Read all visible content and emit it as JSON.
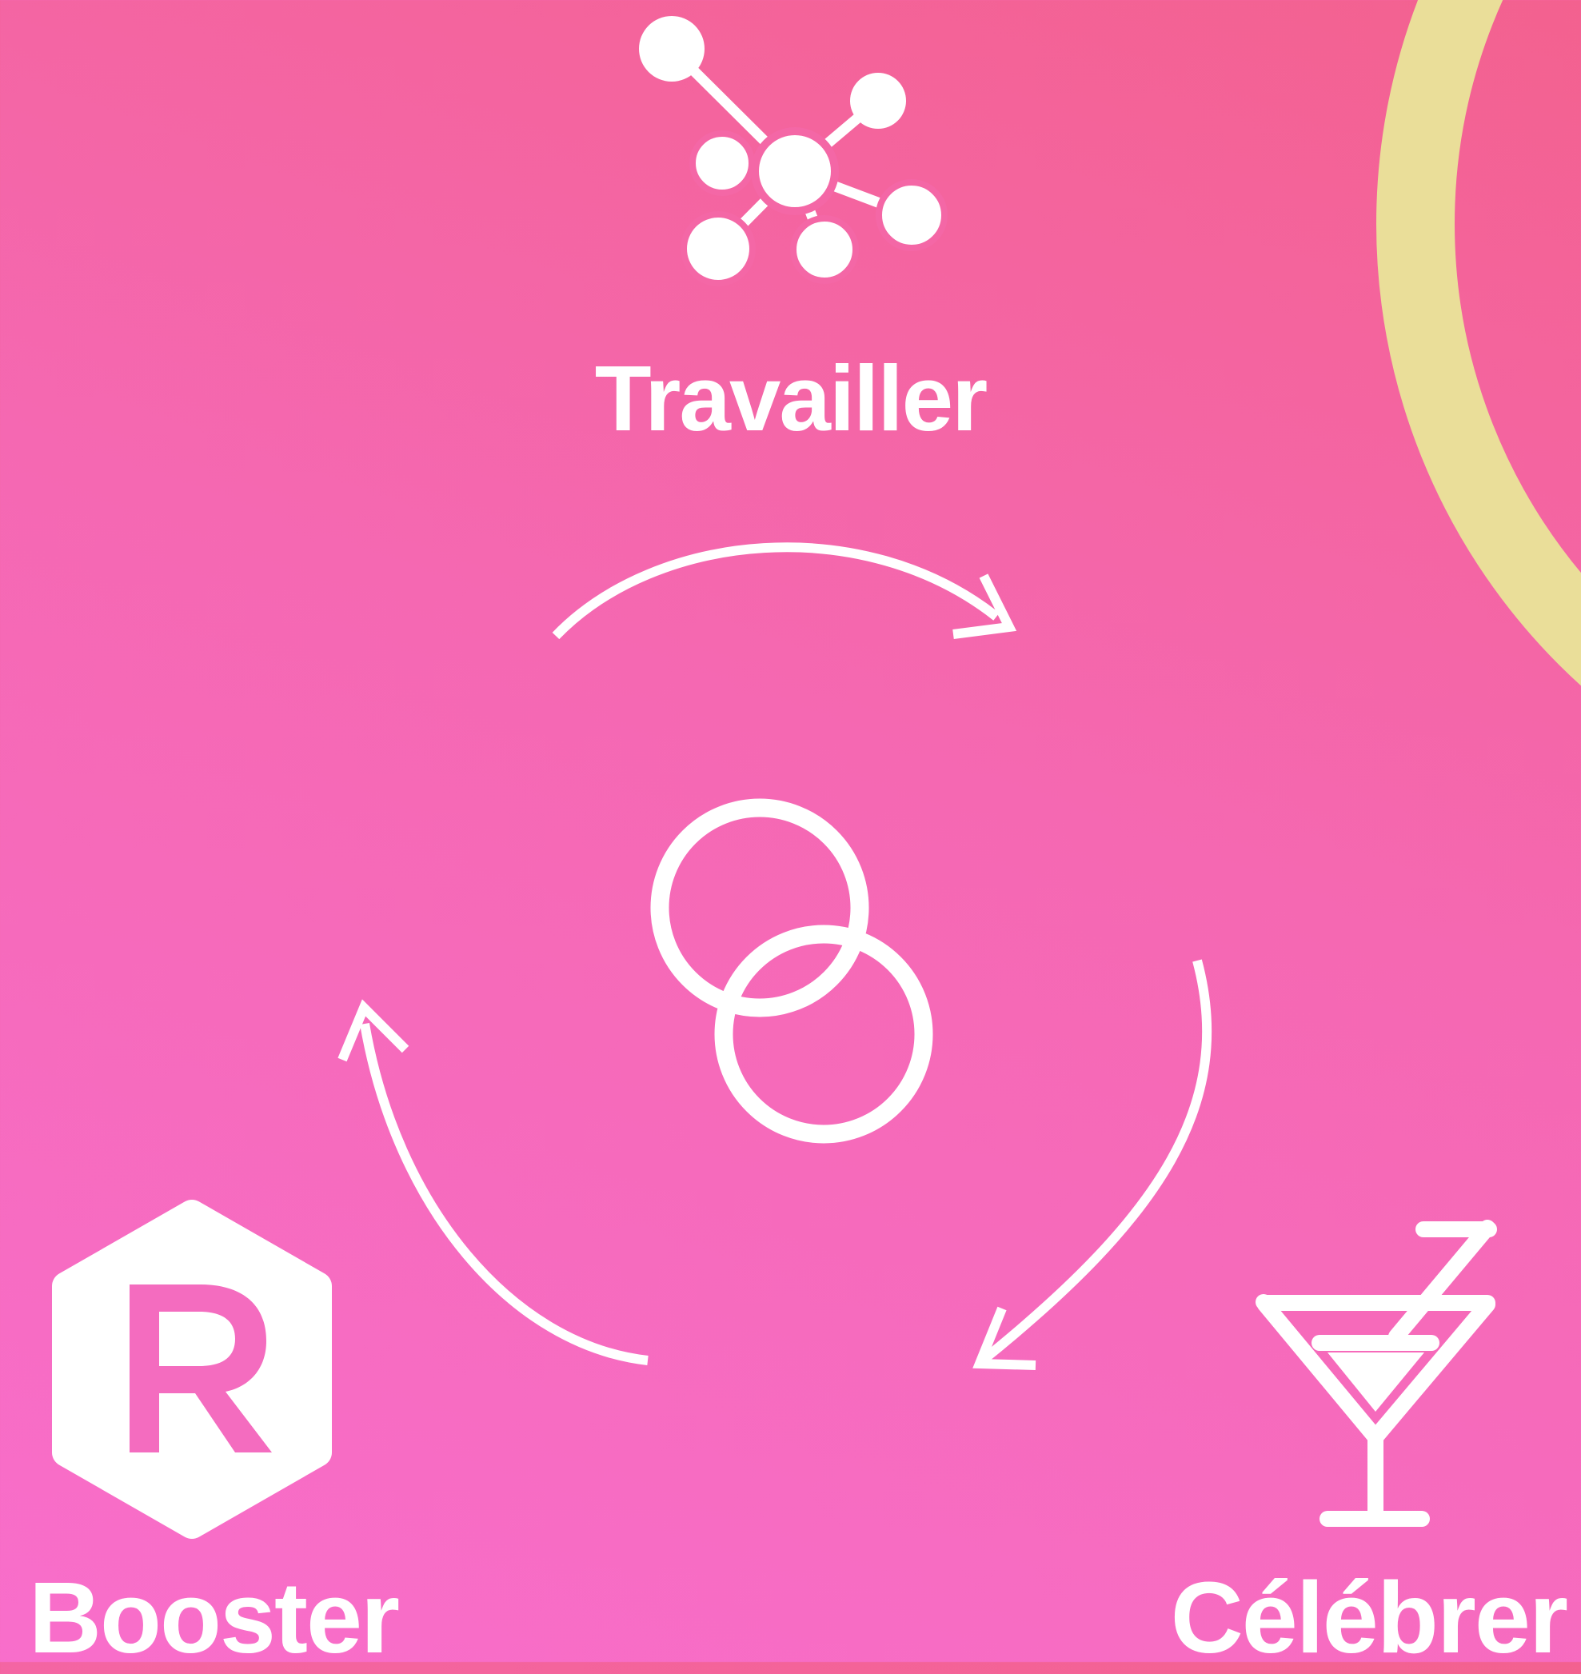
{
  "diagram": {
    "steps": [
      {
        "id": "travailler",
        "label": "Travailler",
        "icon": "network-icon"
      },
      {
        "id": "celebrer",
        "label": "Célébrer",
        "icon": "cocktail-icon"
      },
      {
        "id": "booster",
        "label": "Booster",
        "icon": "r-hexagon-logo-icon"
      }
    ],
    "center_icon": "interlinked-rings-icon",
    "flow": "clockwise"
  },
  "colors": {
    "background_start": "#f3618f",
    "background_end": "#f86ecb",
    "foreground": "#ffffff",
    "accent_ring": "#eade99"
  }
}
